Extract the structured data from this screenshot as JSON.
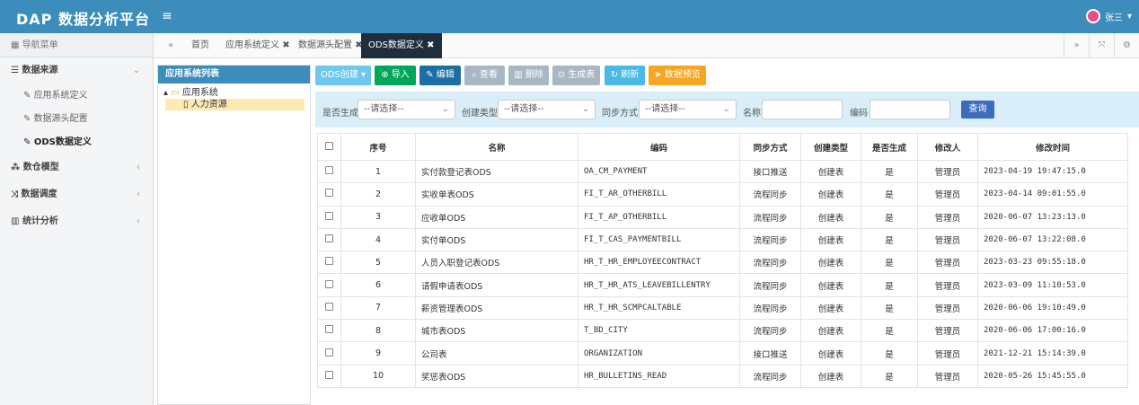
{
  "app": {
    "title": "DAP 数据分析平台",
    "menu_icon": "≡",
    "user_name": "张三"
  },
  "sidebar": {
    "header": "导航菜单",
    "groups": [
      {
        "label": "数据来源",
        "icon": "database-icon",
        "expanded": true,
        "items": [
          "应用系统定义",
          "数据源头配置",
          "ODS数据定义"
        ]
      },
      {
        "label": "数仓模型",
        "icon": "cubes-icon"
      },
      {
        "label": "数据调度",
        "icon": "shuffle-icon"
      },
      {
        "label": "统计分析",
        "icon": "bar-chart-icon"
      }
    ]
  },
  "tabs": [
    {
      "label": "首页",
      "closable": false
    },
    {
      "label": "应用系统定义",
      "closable": true
    },
    {
      "label": "数据源头配置",
      "closable": true
    },
    {
      "label": "ODS数据定义",
      "closable": true,
      "active": true
    }
  ],
  "tree": {
    "header": "应用系统列表",
    "root": "应用系统",
    "child": "人力资源"
  },
  "toolbar": {
    "ods_create": "ODS创建",
    "import": "导入",
    "edit": "编辑",
    "view": "查看",
    "delete": "删除",
    "gen_table": "生成表",
    "refresh": "刷新",
    "preview": "数据预览"
  },
  "filters": {
    "generated_label": "是否生成",
    "generated_placeholder": "--请选择--",
    "create_type_label": "创建类型",
    "create_type_placeholder": "--请选择--",
    "sync_label": "同步方式",
    "sync_placeholder": "--请选择--",
    "name_label": "名称",
    "code_label": "编码",
    "query_button": "查询"
  },
  "table": {
    "columns": [
      "序号",
      "名称",
      "编码",
      "同步方式",
      "创建类型",
      "是否生成",
      "修改人",
      "修改时间"
    ],
    "rows": [
      [
        "1",
        "实付款登记表ODS",
        "OA_CM_PAYMENT",
        "接口推送",
        "创建表",
        "是",
        "管理员",
        "2023-04-19 19:47:15.0"
      ],
      [
        "2",
        "实收单表ODS",
        "FI_T_AR_OTHERBILL",
        "流程同步",
        "创建表",
        "是",
        "管理员",
        "2023-04-14 09:01:55.0"
      ],
      [
        "3",
        "应收单ODS",
        "FI_T_AP_OTHERBILL",
        "流程同步",
        "创建表",
        "是",
        "管理员",
        "2020-06-07 13:23:13.0"
      ],
      [
        "4",
        "实付单ODS",
        "FI_T_CAS_PAYMENTBILL",
        "流程同步",
        "创建表",
        "是",
        "管理员",
        "2020-06-07 13:22:08.0"
      ],
      [
        "5",
        "人员入职登记表ODS",
        "HR_T_HR_EMPLOYEECONTRACT",
        "流程同步",
        "创建表",
        "是",
        "管理员",
        "2023-03-23 09:55:18.0"
      ],
      [
        "6",
        "请假申请表ODS",
        "HR_T_HR_ATS_LEAVEBILLENTRY",
        "流程同步",
        "创建表",
        "是",
        "管理员",
        "2023-03-09 11:10:53.0"
      ],
      [
        "7",
        "薪资管理表ODS",
        "HR_T_HR_SCMPCALTABLE",
        "流程同步",
        "创建表",
        "是",
        "管理员",
        "2020-06-06 19:10:49.0"
      ],
      [
        "8",
        "城市表ODS",
        "T_BD_CITY",
        "流程同步",
        "创建表",
        "是",
        "管理员",
        "2020-06-06 17:00:16.0"
      ],
      [
        "9",
        "公司表",
        "ORGANIZATION",
        "接口推送",
        "创建表",
        "是",
        "管理员",
        "2021-12-21 15:14:39.0"
      ],
      [
        "10",
        "奖惩表ODS",
        "HR_BULLETINS_READ",
        "流程同步",
        "创建表",
        "是",
        "管理员",
        "2020-05-26 15:45:55.0"
      ]
    ]
  },
  "colors": {
    "topbar": "#3c8dbc",
    "active_tab": "#1f2d3d",
    "filter_bg": "#d9eef8",
    "tree_selected": "#fce9b4"
  }
}
